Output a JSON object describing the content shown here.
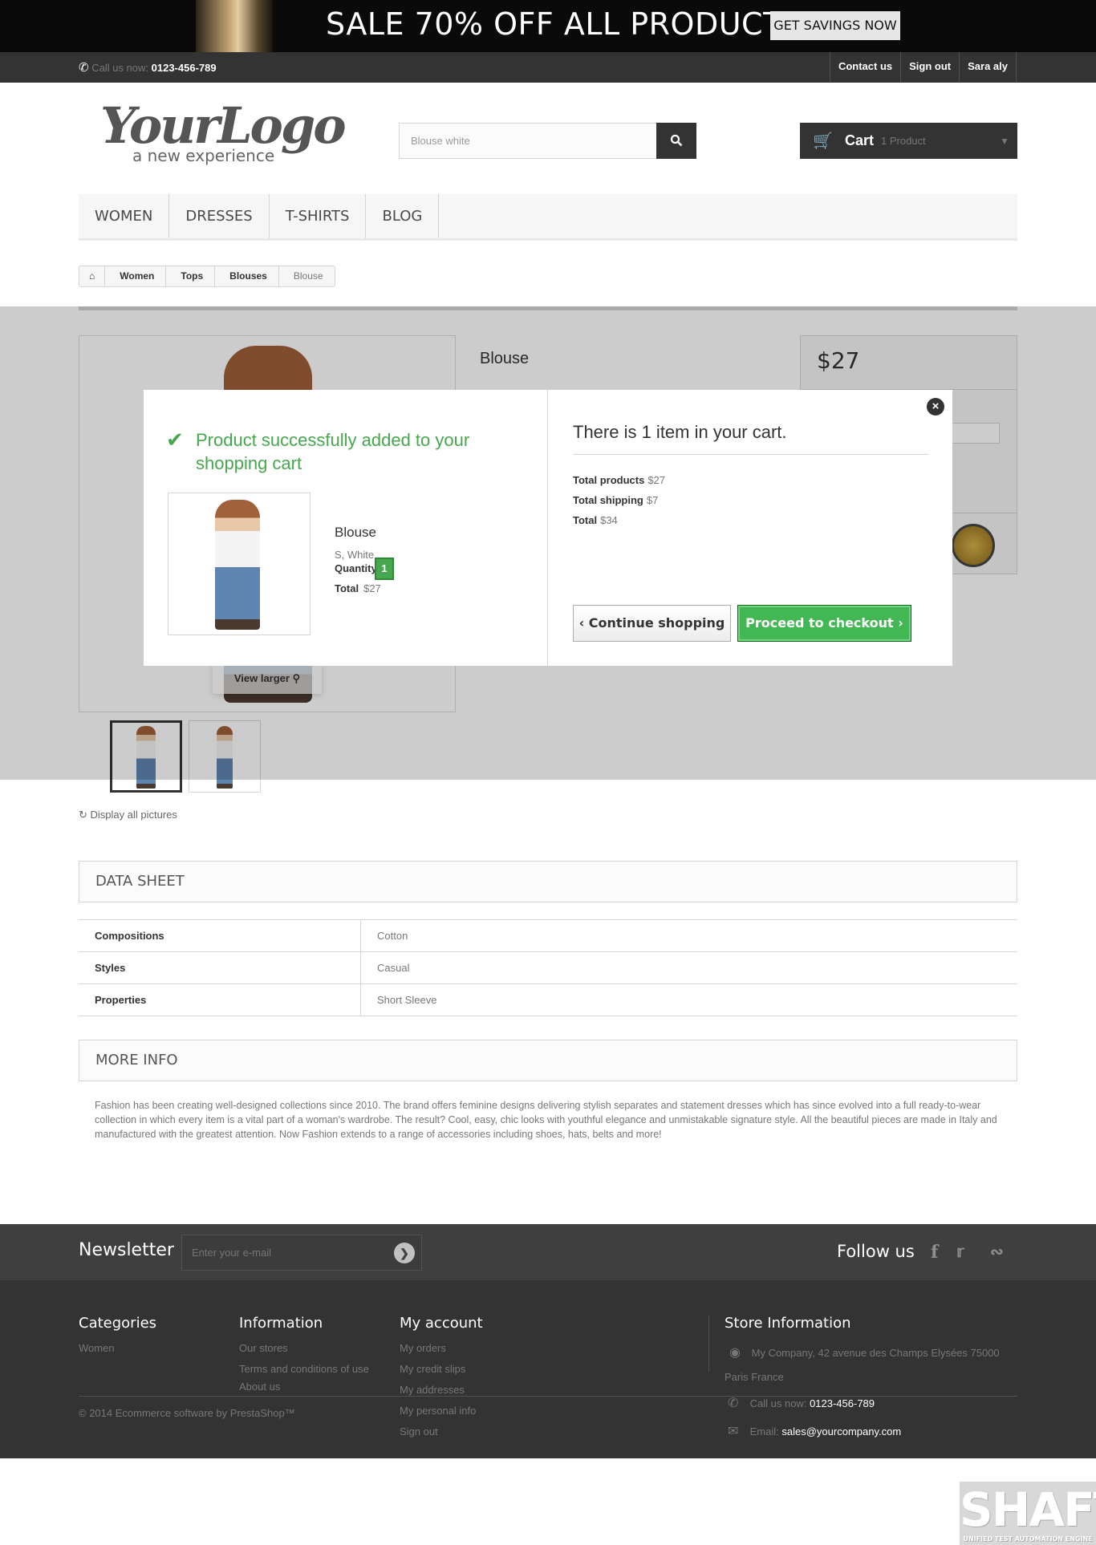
{
  "banner": {
    "title": "SALE 70% OFF ALL PRODUCTS",
    "button": "GET SAVINGS NOW"
  },
  "topbar": {
    "phone_label": "Call us now:",
    "phone_number": "0123-456-789",
    "links": [
      "Contact us",
      "Sign out",
      "Sara aly"
    ]
  },
  "logo": {
    "title": "YourLogo",
    "subtitle": "a new experience"
  },
  "search": {
    "value": "Blouse white",
    "icon": "search-icon"
  },
  "cart": {
    "label": "Cart",
    "count": "1 Product",
    "icon": "shopping-cart-icon"
  },
  "menu": [
    "WOMEN",
    "DRESSES",
    "T-SHIRTS",
    "BLOG"
  ],
  "breadcrumb": [
    "Women",
    "Tops",
    "Blouses",
    "Blouse"
  ],
  "product": {
    "name": "Blouse",
    "price": "$27",
    "view_larger": "View larger",
    "display_all": "Display all pictures"
  },
  "modal": {
    "success": "Product successfully added to your shopping cart",
    "product_name": "Blouse",
    "attributes": "S, White",
    "quantity_label": "Quantity",
    "quantity": "1",
    "total_label": "Total",
    "total": "$27",
    "cart_title": "There is 1 item in your cart.",
    "totals": [
      {
        "label": "Total products",
        "value": "$27"
      },
      {
        "label": "Total shipping",
        "value": "$7"
      },
      {
        "label": "Total",
        "value": "$34"
      }
    ],
    "continue": "Continue shopping",
    "checkout": "Proceed to checkout"
  },
  "datasheet": {
    "title": "DATA SHEET",
    "rows": [
      {
        "k": "Compositions",
        "v": "Cotton"
      },
      {
        "k": "Styles",
        "v": "Casual"
      },
      {
        "k": "Properties",
        "v": "Short Sleeve"
      }
    ]
  },
  "moreinfo": {
    "title": "MORE INFO",
    "text": "Fashion has been creating well-designed collections since 2010. The brand offers feminine designs delivering stylish separates and statement dresses which has since evolved into a full ready-to-wear collection in which every item is a vital part of a woman's wardrobe. The result? Cool, easy, chic looks with youthful elegance and unmistakable signature style. All the beautiful pieces are made in Italy and manufactured with the greatest attention. Now Fashion extends to a range of accessories including shoes, hats, belts and more!"
  },
  "newsletter": {
    "title": "Newsletter",
    "placeholder": "Enter your e-mail",
    "follow": "Follow us",
    "social_icons": [
      "facebook-icon",
      "twitter-icon",
      "rss-icon"
    ]
  },
  "footer": {
    "categories": {
      "title": "Categories",
      "items": [
        "Women"
      ]
    },
    "information": {
      "title": "Information",
      "items": [
        "Our stores",
        "Terms and conditions of use",
        "About us"
      ]
    },
    "account": {
      "title": "My account",
      "items": [
        "My orders",
        "My credit slips",
        "My addresses",
        "My personal info",
        "Sign out"
      ]
    },
    "store": {
      "title": "Store Information",
      "address": "My Company, 42 avenue des Champs Elysées 75000 Paris France",
      "phone_label": "Call us now:",
      "phone": "0123-456-789",
      "email_label": "Email:",
      "email": "sales@yourcompany.com"
    },
    "copyright": "© 2014 Ecommerce software by PrestaShop™"
  },
  "watermark": {
    "title": "SHAFT",
    "subtitle": "UNIFIED TEST AUTOMATION ENGINE"
  }
}
